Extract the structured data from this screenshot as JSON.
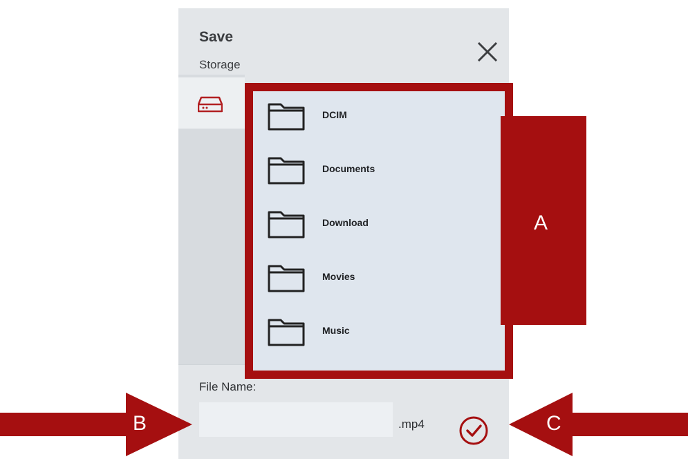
{
  "dialog": {
    "title": "Save",
    "subtitle": "Storage"
  },
  "sidebar": {
    "items": [
      {
        "name": "storage",
        "icon": "hard-drive-icon",
        "selected": true
      }
    ]
  },
  "folders": [
    {
      "label": "DCIM",
      "icon": "folder-icon"
    },
    {
      "label": "Documents",
      "icon": "folder-icon"
    },
    {
      "label": "Download",
      "icon": "folder-icon"
    },
    {
      "label": "Movies",
      "icon": "folder-icon"
    },
    {
      "label": "Music",
      "icon": "folder-icon"
    }
  ],
  "file": {
    "label": "File Name:",
    "value": "",
    "placeholder": "",
    "extension": ".mp4"
  },
  "actions": {
    "close_icon": "close-icon",
    "confirm_icon": "check-circle-icon"
  },
  "annotations": {
    "a": "A",
    "b": "B",
    "c": "C"
  },
  "colors": {
    "accent": "#a50f10",
    "panel": "#dfe6ee",
    "background": "#e3e6e9"
  }
}
